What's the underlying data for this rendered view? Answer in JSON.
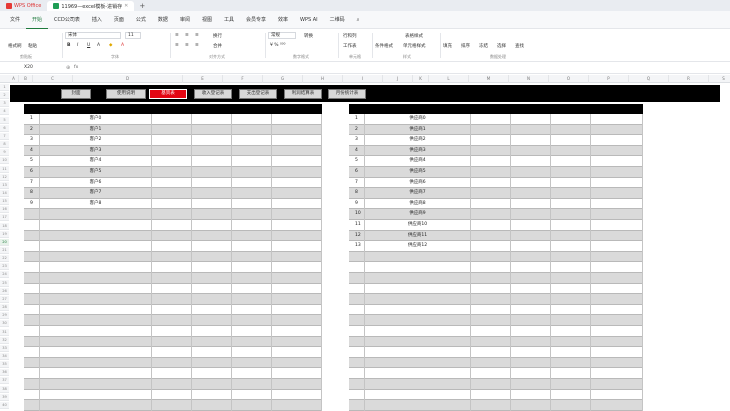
{
  "titlebar": {
    "app_name": "WPS Office",
    "doc_tab": "11969—excel模板-进销存"
  },
  "menubar": {
    "items": [
      "文件",
      "开始",
      "CCD公司表",
      "插入",
      "页面",
      "公式",
      "数据",
      "审阅",
      "视图",
      "工具",
      "会员专享",
      "效率",
      "WPS AI",
      "二维码"
    ]
  },
  "ribbon": {
    "format_painter": "格式刷",
    "paste": "粘贴",
    "font_name": "宋体",
    "font_size": "11",
    "group_clipboard": "剪贴板",
    "group_font": "字体",
    "group_align": "对齐方式",
    "group_number": "数字格式",
    "group_cells": "单元格",
    "group_style": "样式",
    "group_data": "数据处理",
    "number_format": "常规",
    "convert": "转换",
    "rows_cols": "行和列",
    "worksheet": "工作表",
    "conditional_format": "条件格式",
    "cell_style": "单元格样式",
    "fill": "填充",
    "sort": "排序",
    "freeze": "冻结",
    "find": "查找",
    "select": "选择",
    "table_style": "表格样式",
    "merge": "合并",
    "wrap": "换行"
  },
  "formulabar": {
    "cell_ref": "X20",
    "fx": "fx"
  },
  "columns": [
    "A",
    "B",
    "C",
    "D",
    "E",
    "F",
    "G",
    "H",
    "I",
    "J",
    "K",
    "L",
    "M",
    "N",
    "O",
    "P",
    "Q",
    "R",
    "S"
  ],
  "rows": [
    "1",
    "2",
    "3",
    "4",
    "5",
    "6",
    "7",
    "8",
    "9",
    "10",
    "11",
    "12",
    "13",
    "14",
    "15",
    "16",
    "17",
    "18",
    "19",
    "20",
    "21",
    "22",
    "23",
    "24",
    "25",
    "26",
    "27",
    "28",
    "29",
    "30",
    "31",
    "32",
    "33",
    "34",
    "35",
    "36",
    "37",
    "38",
    "39",
    "40"
  ],
  "selected_row": "20",
  "nav": {
    "buttons": [
      "封面",
      "使用说明",
      "基资表",
      "收入登记表",
      "支出登记表",
      "利润结算表",
      "月份统计表"
    ],
    "active_index": 2
  },
  "customers": [
    {
      "no": "1",
      "name": "客户0"
    },
    {
      "no": "2",
      "name": "客户1"
    },
    {
      "no": "3",
      "name": "客户2"
    },
    {
      "no": "4",
      "name": "客户3"
    },
    {
      "no": "5",
      "name": "客户4"
    },
    {
      "no": "6",
      "name": "客户5"
    },
    {
      "no": "7",
      "name": "客户6"
    },
    {
      "no": "8",
      "name": "客户7"
    },
    {
      "no": "9",
      "name": "客户8"
    }
  ],
  "suppliers": [
    {
      "no": "1",
      "name": "供应商0"
    },
    {
      "no": "2",
      "name": "供应商1"
    },
    {
      "no": "3",
      "name": "供应商2"
    },
    {
      "no": "4",
      "name": "供应商3"
    },
    {
      "no": "5",
      "name": "供应商4"
    },
    {
      "no": "6",
      "name": "供应商5"
    },
    {
      "no": "7",
      "name": "供应商6"
    },
    {
      "no": "8",
      "name": "供应商7"
    },
    {
      "no": "9",
      "name": "供应商8"
    },
    {
      "no": "10",
      "name": "供应商9"
    },
    {
      "no": "11",
      "name": "供应商10"
    },
    {
      "no": "12",
      "name": "供应商11"
    },
    {
      "no": "13",
      "name": "供应商12"
    }
  ],
  "colors": {
    "active_nav": "#e30613",
    "brand_green": "#1e7a3c",
    "alt_row": "#dadada"
  }
}
